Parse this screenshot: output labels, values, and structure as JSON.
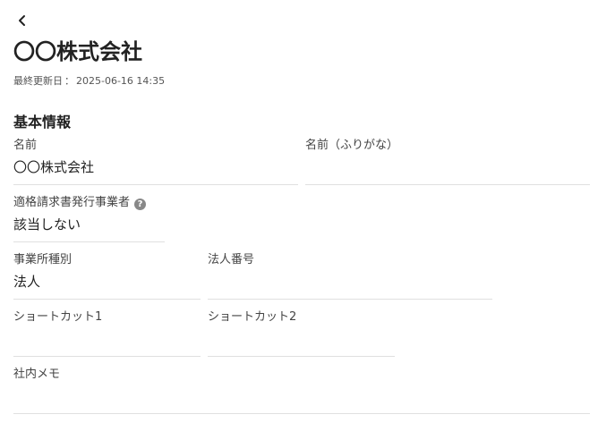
{
  "page": {
    "title": "〇〇株式会社",
    "updated_label": "最終更新日",
    "updated_sep": "：",
    "updated_value": "2025-06-16 14:35"
  },
  "section": {
    "title": "基本情報"
  },
  "fields": {
    "name": {
      "label": "名前",
      "value": "〇〇株式会社"
    },
    "name_kana": {
      "label": "名前（ふりがな）",
      "value": ""
    },
    "invoice_issuer": {
      "label": "適格請求書発行事業者",
      "value": "該当しない",
      "help": "?"
    },
    "office_type": {
      "label": "事業所種別",
      "value": "法人"
    },
    "corporate_number": {
      "label": "法人番号",
      "value": ""
    },
    "shortcut1": {
      "label": "ショートカット1",
      "value": ""
    },
    "shortcut2": {
      "label": "ショートカット2",
      "value": ""
    },
    "memo": {
      "label": "社内メモ",
      "value": ""
    }
  },
  "icons": {
    "back": "chevron-left-icon",
    "help": "question-circle-icon"
  }
}
